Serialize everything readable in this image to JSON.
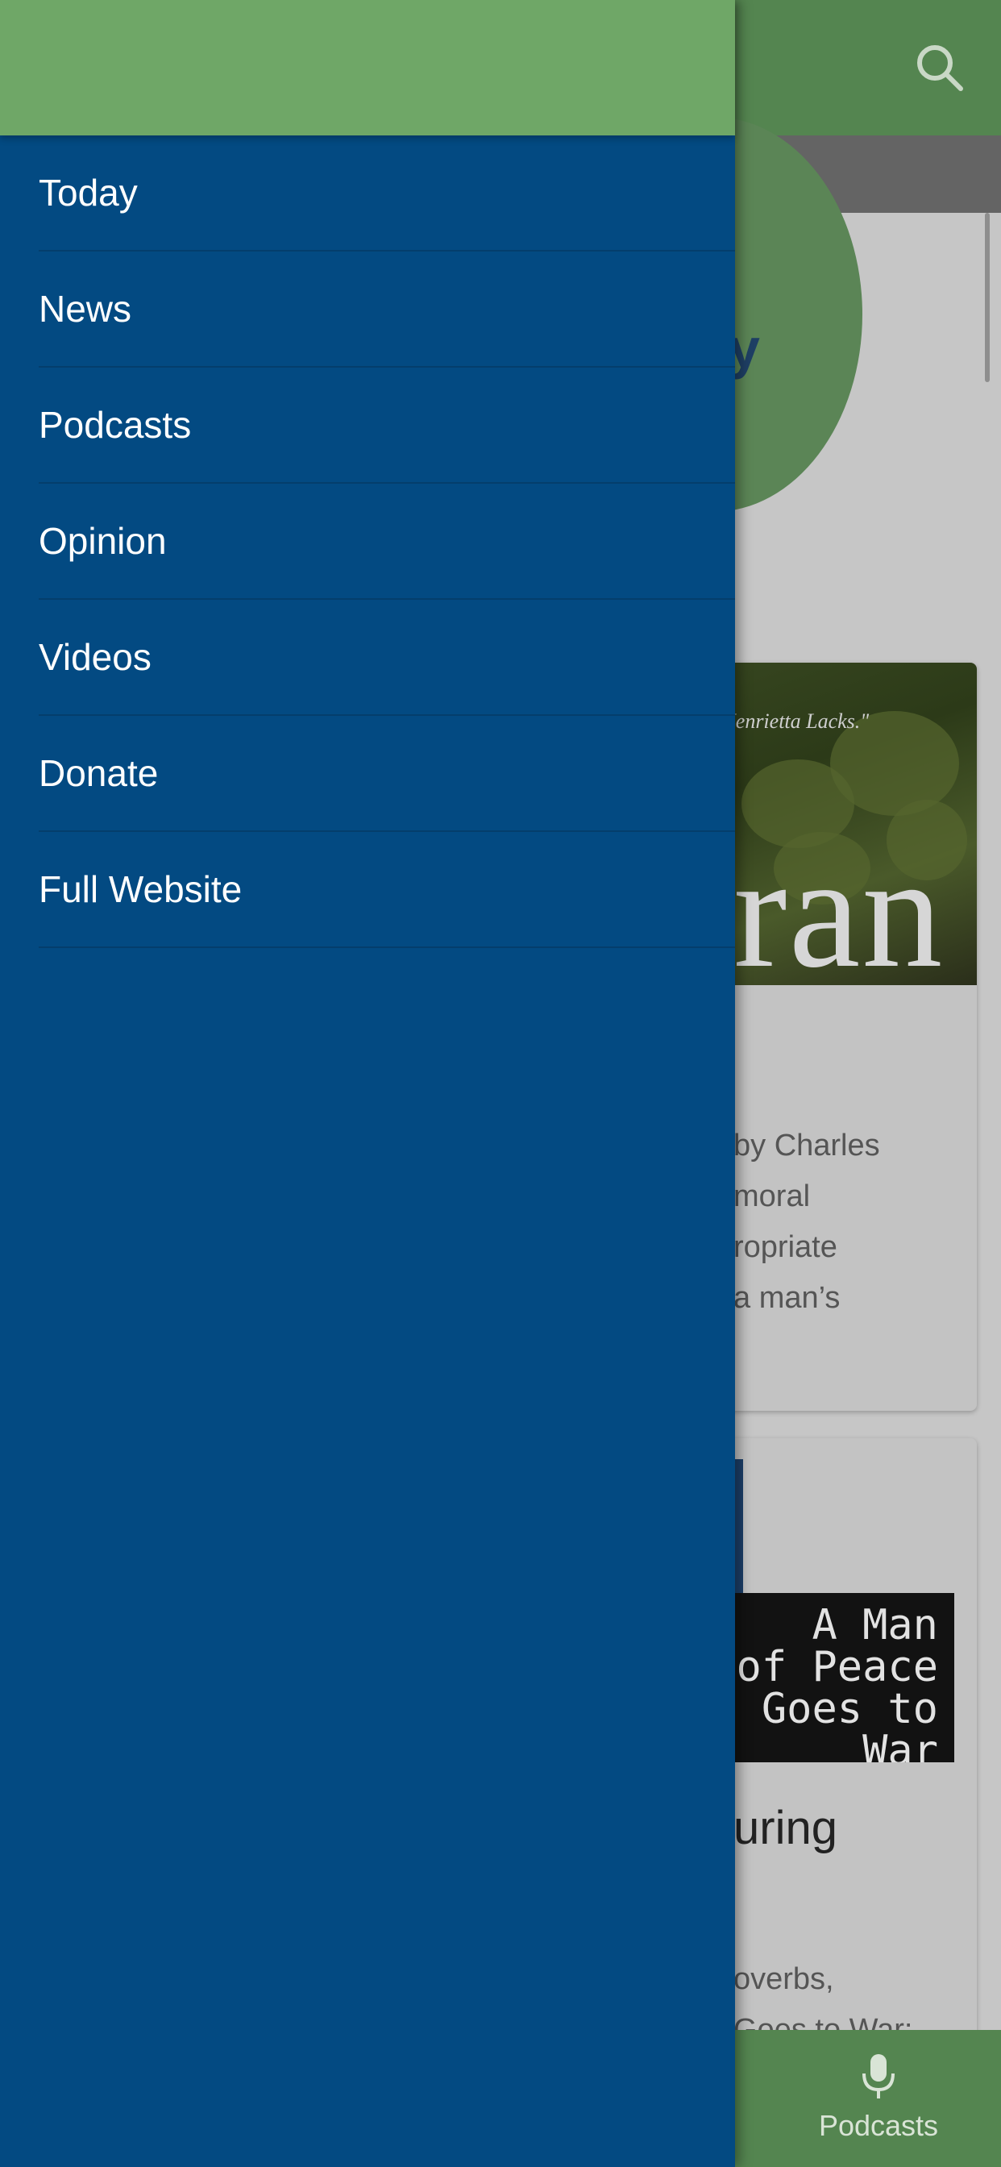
{
  "app": {
    "header": {
      "search_icon": "search-icon"
    },
    "card1": {
      "image_quote": "Henrietta Lacks.\"",
      "image_bigword": "ran",
      "snippet": "by Charles\n moral\nropriate\na man’s"
    },
    "card2": {
      "image_title": "A Man\nof Peace\nGoes to\nWar",
      "heading": "uring",
      "snippet": "overbs,\nGoes to War:"
    },
    "bottom_tab": {
      "label": "Podcasts",
      "icon": "microphone-icon"
    },
    "colors": {
      "header_green": "#548550",
      "drawer_blue": "#034a82",
      "drawer_header_green": "#6fa767"
    }
  },
  "drawer": {
    "items": [
      {
        "label": "Today"
      },
      {
        "label": "News"
      },
      {
        "label": "Podcasts"
      },
      {
        "label": "Opinion"
      },
      {
        "label": "Videos"
      },
      {
        "label": "Donate"
      },
      {
        "label": "Full Website"
      }
    ]
  }
}
